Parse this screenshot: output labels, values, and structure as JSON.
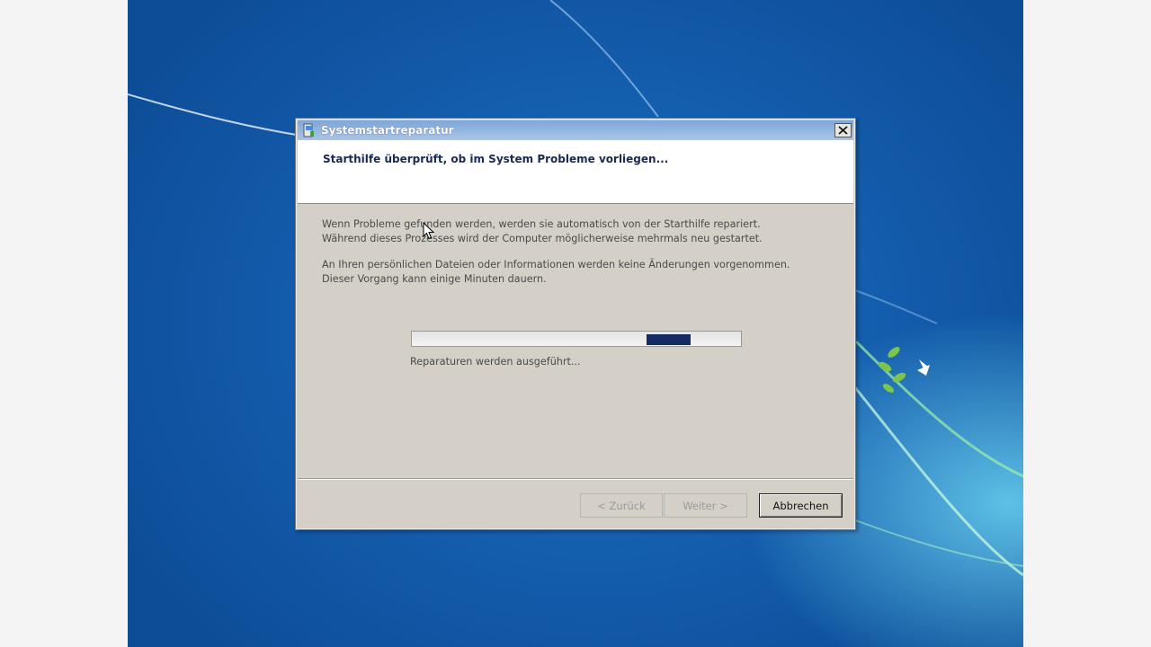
{
  "window": {
    "title": "Systemstartreparatur",
    "heading": "Starthilfe überprüft, ob im System Probleme vorliegen..."
  },
  "body": {
    "paragraph1_line1": "Wenn Probleme gefunden werden, werden sie automatisch von der Starthilfe repariert.",
    "paragraph1_line2": "Während dieses Prozesses wird der Computer möglicherweise mehrmals neu gestartet.",
    "paragraph2_line1": "An Ihren persönlichen Dateien oder Informationen werden keine Änderungen vorgenommen.",
    "paragraph2_line2": "Dieser Vorgang kann einige Minuten dauern."
  },
  "progress": {
    "label": "Reparaturen werden ausgeführt...",
    "mode": "indeterminate-marquee"
  },
  "buttons": {
    "back": "< Zurück",
    "next": "Weiter >",
    "cancel": "Abbrechen"
  },
  "icons": {
    "title": "setup-window-icon",
    "close": "close-icon",
    "cursor": "mouse-pointer-icon"
  },
  "colors": {
    "desktop_blue": "#1560b0",
    "titlebar": "#7ea6d8",
    "progress_fill": "#142c62",
    "dialog_face": "#d4d0c8"
  }
}
